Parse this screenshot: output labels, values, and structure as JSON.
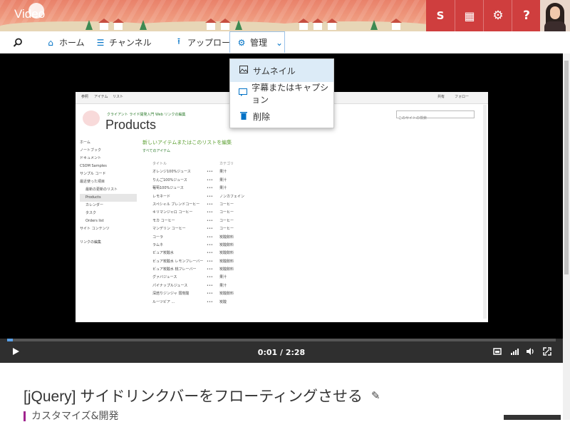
{
  "suite_bar": {
    "app_title": "Video",
    "tiles": [
      {
        "icon": "sharepoint-icon",
        "glyph": "S"
      },
      {
        "icon": "app-launcher-icon",
        "glyph": "▦"
      },
      {
        "icon": "gear-icon",
        "glyph": "⚙"
      },
      {
        "icon": "help-icon",
        "glyph": "?"
      }
    ],
    "accent_color": "#cf3e3e"
  },
  "nav": {
    "search_icon": "search-icon",
    "items": [
      {
        "label": "ホーム",
        "icon": "home-icon"
      },
      {
        "label": "チャンネル",
        "icon": "list-icon"
      },
      {
        "label": "アップロード",
        "icon": "upload-icon"
      },
      {
        "label": "管理",
        "icon": "gear-icon"
      }
    ]
  },
  "manage_menu": {
    "items": [
      {
        "label": "サムネイル",
        "icon": "image-icon"
      },
      {
        "label": "字幕またはキャプション",
        "icon": "caption-icon"
      },
      {
        "label": "削除",
        "icon": "trash-icon"
      }
    ]
  },
  "video_frame": {
    "tabs": [
      "参照",
      "アイテム",
      "リスト"
    ],
    "top_right": [
      "共有",
      "フォロー"
    ],
    "site_subtitle": "クライアント ライド開発入門    Web    リンクの編集",
    "page_title": "Products",
    "search_placeholder": "このサイトの検索",
    "left_nav": [
      "ホーム",
      "ノートブック",
      "ドキュメント",
      "CSOM Samples",
      "サンプル コード",
      "最近使った項目",
      "最新の更新のリスト",
      "Products",
      "カレンダー",
      "タスク",
      "Orders list",
      "サイト コンテンツ",
      "リンクの編集"
    ],
    "new_item": "新しいアイテムまたはこのリストを編集",
    "view_label": "すべてのアイテム",
    "list_header": [
      "タイトル",
      "カテゴリ"
    ],
    "rows": [
      [
        "オレンジ100%ジュース",
        "果汁"
      ],
      [
        "りんご100%ジュース",
        "果汁"
      ],
      [
        "葡萄100%ジュース",
        "果汁"
      ],
      [
        "レモネード",
        "ノンカフェイン"
      ],
      [
        "スペシャル ブレンドコーヒー",
        "コーヒー"
      ],
      [
        "キリマンジャロ コーヒー",
        "コーヒー"
      ],
      [
        "モカ コーヒー",
        "コーヒー"
      ],
      [
        "マンデリン コーヒー",
        "コーヒー"
      ],
      [
        "コーラ",
        "炭酸飲料"
      ],
      [
        "ラムネ",
        "炭酸飲料"
      ],
      [
        "ビュア炭酸水",
        "炭酸飲料"
      ],
      [
        "ビュア炭酸水 レモンフレーバー",
        "炭酸飲料"
      ],
      [
        "ビュア炭酸水 桃フレーバー",
        "炭酸飲料"
      ],
      [
        "グァバジュース",
        "果汁"
      ],
      [
        "パイナップルジュース",
        "果汁"
      ],
      [
        "深焙りジンジャ 弱炭酸",
        "炭酸飲料"
      ],
      [
        "ルーツビア ...",
        "炭酸"
      ]
    ]
  },
  "player": {
    "time": "0:01 / 2:28",
    "progress_fraction": 0.01,
    "buttons": [
      "play-icon",
      "cast-icon",
      "quality-icon",
      "volume-icon",
      "fullscreen-icon"
    ]
  },
  "video": {
    "title": "[jQuery] サイドリンクバーをフローティングさせる",
    "category": "カスタマイズ&開発"
  }
}
